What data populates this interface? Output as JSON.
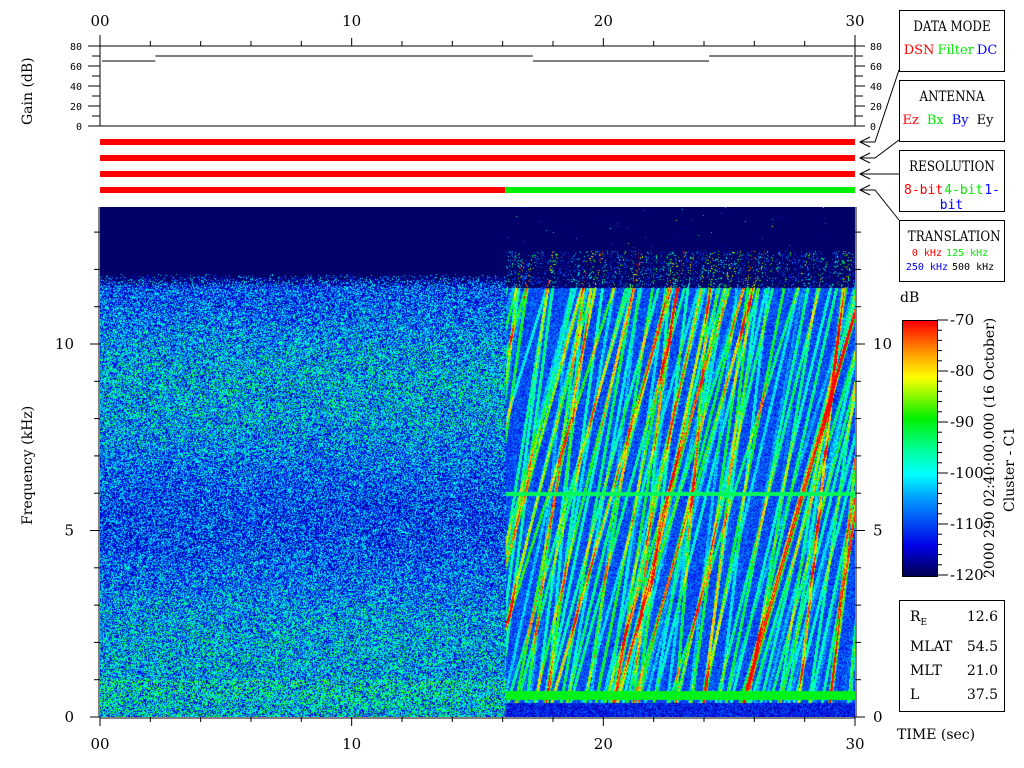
{
  "chart_data": [
    {
      "type": "line",
      "ylabel": "Gain (dB)",
      "ylim": [
        0,
        80
      ],
      "yticks": [
        "80",
        "60",
        "40",
        "20",
        "0"
      ],
      "xlim": [
        0,
        30
      ],
      "xticks": [
        "00",
        "10",
        "20",
        "30"
      ],
      "steps": [
        {
          "from": 0,
          "to": 2.2,
          "gain": 65
        },
        {
          "from": 2.2,
          "to": 17.2,
          "gain": 70
        },
        {
          "from": 17.2,
          "to": 24.2,
          "gain": 65
        },
        {
          "from": 24.2,
          "to": 30,
          "gain": 70
        }
      ]
    },
    {
      "type": "table",
      "name": "status-bars",
      "rows": [
        {
          "label": "DATA MODE",
          "segments": [
            {
              "from": 0,
              "to": 30,
              "color": "#ff0000"
            }
          ]
        },
        {
          "label": "ANTENNA",
          "segments": [
            {
              "from": 0,
              "to": 30,
              "color": "#ff0000"
            }
          ]
        },
        {
          "label": "RESOLUTION",
          "segments": [
            {
              "from": 0,
              "to": 30,
              "color": "#ff0000"
            }
          ]
        },
        {
          "label": "TRANSLATION",
          "segments": [
            {
              "from": 0,
              "to": 16.1,
              "color": "#ff0000"
            },
            {
              "from": 16.1,
              "to": 30,
              "color": "#00ee00"
            }
          ]
        }
      ]
    },
    {
      "type": "heatmap",
      "xlabel": "TIME (sec)",
      "ylabel": "Frequency (kHz)",
      "xlim": [
        0,
        30
      ],
      "ylim": [
        0,
        13.7
      ],
      "xticks": [
        "00",
        "10",
        "20",
        "30"
      ],
      "yticks": [
        "0",
        "5",
        "10"
      ],
      "colorbar": {
        "label": "dB",
        "range": [
          -120,
          -70
        ],
        "ticks": [
          "-70",
          "-80",
          "-90",
          "-100",
          "-110",
          "-120"
        ]
      },
      "features": {
        "mode_change_time": 16.1,
        "left_cutoff_khz": 11.5,
        "line_khz": 6.0,
        "low_band_khz": 0.6
      }
    }
  ],
  "legend": {
    "data_mode": {
      "title": "DATA MODE",
      "items": [
        {
          "text": "DSN",
          "color": "#ff0000"
        },
        {
          "text": "Filter",
          "color": "#00ee00"
        },
        {
          "text": "DC",
          "color": "#0000ff"
        }
      ]
    },
    "antenna": {
      "title": "ANTENNA",
      "items": [
        {
          "text": "Ez",
          "color": "#ff0000"
        },
        {
          "text": "Bx",
          "color": "#00ee00"
        },
        {
          "text": "By",
          "color": "#0000ff"
        },
        {
          "text": "Ey",
          "color": "#000000"
        }
      ]
    },
    "resolution": {
      "title": "RESOLUTION",
      "items": [
        {
          "text": "8-bit",
          "color": "#ff0000"
        },
        {
          "text": "4-bit",
          "color": "#00ee00"
        },
        {
          "text": "1-bit",
          "color": "#0000ff"
        }
      ]
    },
    "translation": {
      "title": "TRANSLATION",
      "items": [
        {
          "text": "0 kHz",
          "color": "#ff0000"
        },
        {
          "text": "125 kHz",
          "color": "#00ee00"
        },
        {
          "text": "250 kHz",
          "color": "#0000ff"
        },
        {
          "text": "500 kHz",
          "color": "#000000"
        }
      ]
    }
  },
  "side_title": "2000 290 02:40:00.000 (16 October)",
  "spacecraft": "Cluster - C1",
  "ephemeris": [
    {
      "label": "R",
      "sub": "E",
      "value": "12.6"
    },
    {
      "label": "MLAT",
      "sub": "",
      "value": "54.5"
    },
    {
      "label": "MLT",
      "sub": "",
      "value": "21.0"
    },
    {
      "label": "L",
      "sub": "",
      "value": "37.5"
    }
  ]
}
